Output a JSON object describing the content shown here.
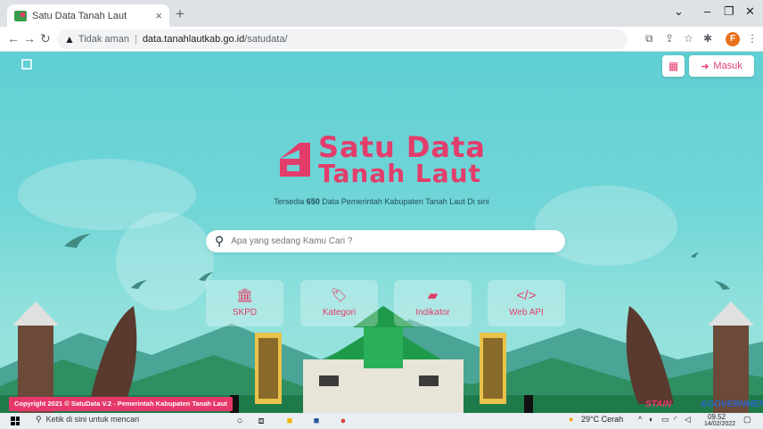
{
  "browser": {
    "tab_title": "Satu Data Tanah Laut",
    "tab_close": "×",
    "new_tab": "+",
    "security_label": "Tidak aman",
    "url_host": "data.tanahlautkab.go.id",
    "url_path": "/satudata/",
    "profile_initial": "F"
  },
  "header": {
    "masuk_label": "Masuk"
  },
  "hero": {
    "logo_line1": "Satu Data",
    "logo_line2": "Tanah Laut",
    "tagline_before": "Tersedia ",
    "tagline_count": "650",
    "tagline_after": " Data Pemerintah Kabupaten Tanah Laut Di sini"
  },
  "search": {
    "placeholder": "Apa yang sedang Kamu Cari ?"
  },
  "categories": [
    {
      "label": "SKPD",
      "icon": "institution-icon"
    },
    {
      "label": "Kategori",
      "icon": "tags-icon"
    },
    {
      "label": "Indikator",
      "icon": "folder-icon"
    },
    {
      "label": "Web API",
      "icon": "code-icon"
    }
  ],
  "footer": {
    "copyright": "Copyright 2021 © SatuData V.2 - Pemerintah Kabupaten Tanah Laut",
    "sponsor_a": "STAIN",
    "sponsor_b": "&GOVERNMENT"
  },
  "taskbar": {
    "search_placeholder": "Ketik di sini untuk mencari",
    "weather": "29°C  Cerah",
    "time": "09.52",
    "date": "14/02/2022"
  },
  "colors": {
    "brand": "#e23d6b",
    "sky": "#6fd0d3"
  }
}
